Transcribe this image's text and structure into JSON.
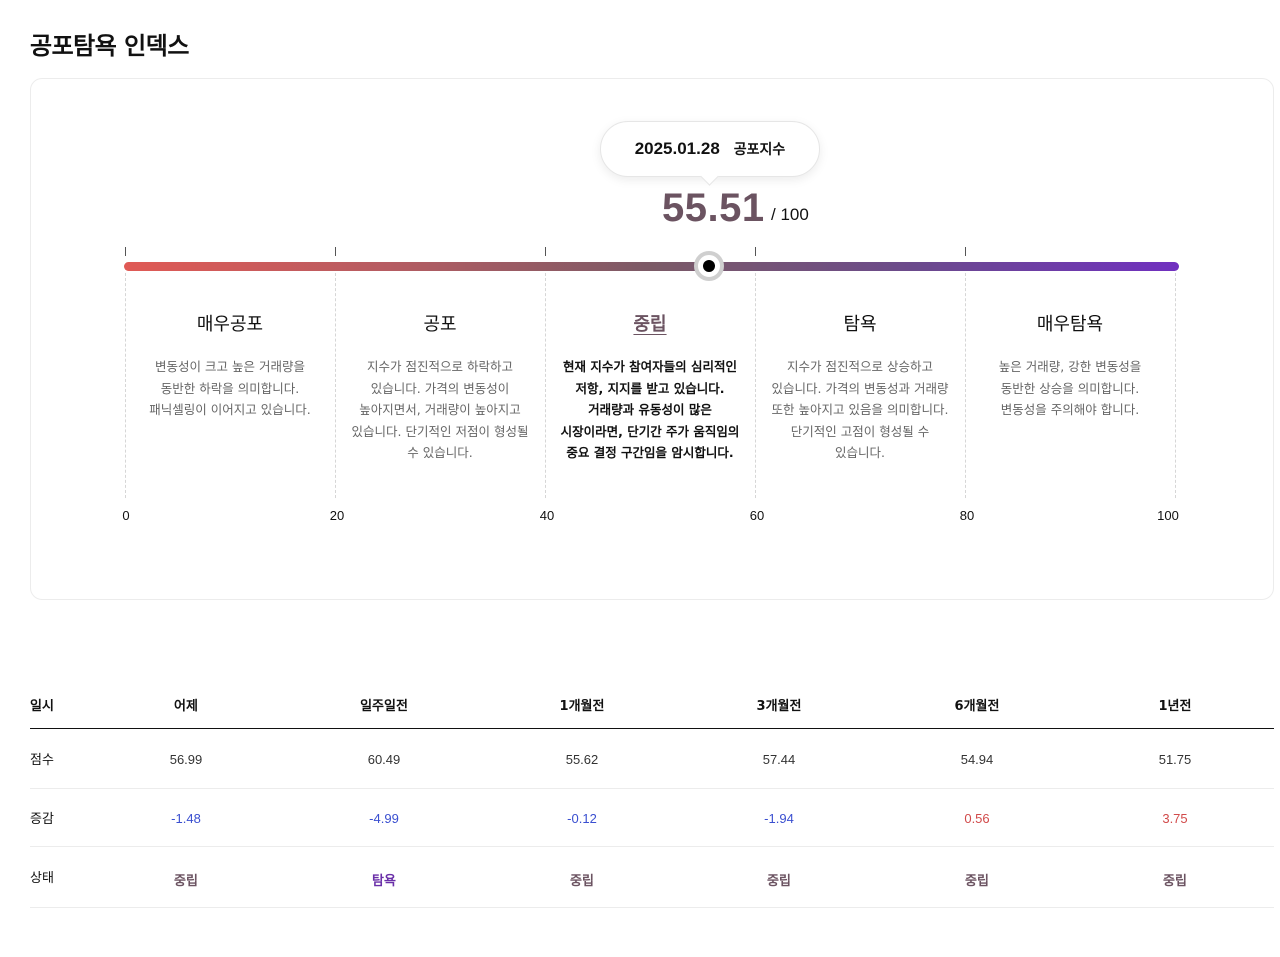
{
  "page": {
    "title": "공포탐욕 인덱스"
  },
  "gauge": {
    "date": "2025.01.28",
    "index_label": "공포지수",
    "score": "55.51",
    "score_max": "/ 100",
    "score_fraction": 0.5551,
    "gradient_colors": [
      "#e05a55",
      "#7b5a66",
      "#7030c0"
    ],
    "accent_color": "#6b5361",
    "ticks": [
      "0",
      "20",
      "40",
      "60",
      "80",
      "100"
    ],
    "zones": [
      {
        "title": "매우공포",
        "desc": "변동성이 크고 높은 거래량을 동반한 하락을 의미합니다. 패닉셀링이 이어지고 있습니다.",
        "active": false
      },
      {
        "title": "공포",
        "desc": "지수가 점진적으로 하락하고 있습니다. 가격의 변동성이 높아지면서, 거래량이 높아지고 있습니다. 단기적인 저점이 형성될 수 있습니다.",
        "active": false
      },
      {
        "title": "중립",
        "desc": "현재 지수가 참여자들의 심리적인 저항, 지지를 받고 있습니다. 거래량과 유동성이 많은 시장이라면, 단기간 주가 움직임의 중요 결정 구간임을 암시합니다.",
        "active": true
      },
      {
        "title": "탐욕",
        "desc": "지수가 점진적으로 상승하고 있습니다. 가격의 변동성과 거래량 또한 높아지고 있음을 의미합니다. 단기적인 고점이 형성될 수 있습니다.",
        "active": false
      },
      {
        "title": "매우탐욕",
        "desc": "높은 거래량, 강한 변동성을 동반한 상승을 의미합니다. 변동성을 주의해야 합니다.",
        "active": false
      }
    ]
  },
  "history_table": {
    "row_labels": {
      "period": "일시",
      "score": "점수",
      "change": "증감",
      "status": "상태"
    },
    "columns": [
      {
        "period": "어제",
        "score": "56.99",
        "change": "-1.48",
        "status": "중립"
      },
      {
        "period": "일주일전",
        "score": "60.49",
        "change": "-4.99",
        "status": "탐욕"
      },
      {
        "period": "1개월전",
        "score": "55.62",
        "change": "-0.12",
        "status": "중립"
      },
      {
        "period": "3개월전",
        "score": "57.44",
        "change": "-1.94",
        "status": "중립"
      },
      {
        "period": "6개월전",
        "score": "54.94",
        "change": "0.56",
        "status": "중립"
      },
      {
        "period": "1년전",
        "score": "51.75",
        "change": "3.75",
        "status": "중립"
      }
    ],
    "colors": {
      "negative": "#3a4fd0",
      "positive": "#d14a4a",
      "neutral": "#6b5361",
      "greed": "#6a2fa8"
    }
  }
}
